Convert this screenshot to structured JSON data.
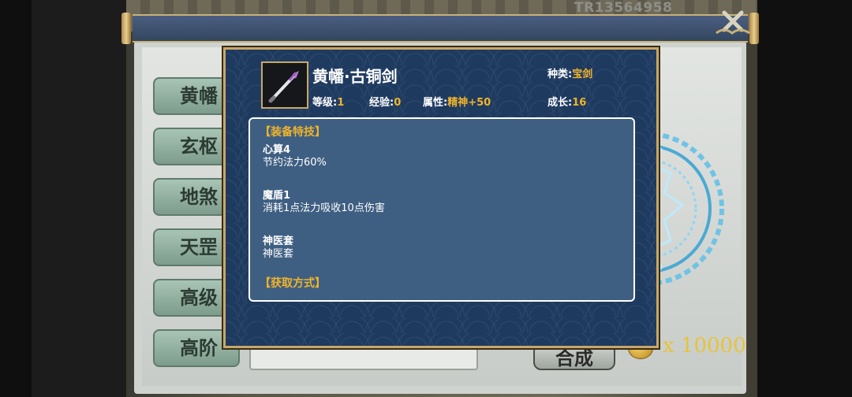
{
  "header": {
    "player_code": "TR13564958"
  },
  "tabs": [
    {
      "label": "黄幡"
    },
    {
      "label": "玄枢"
    },
    {
      "label": "地煞"
    },
    {
      "label": "天罡"
    },
    {
      "label": "高级"
    },
    {
      "label": "高阶"
    }
  ],
  "bottom": {
    "synth_label": "合成",
    "coin_count": "x 10000"
  },
  "tooltip": {
    "item_name": "黄幡·古铜剑",
    "type_label": "种类:",
    "type_value": "宝剑",
    "level_label": "等级:",
    "level_value": "1",
    "exp_label": "经验:",
    "exp_value": "0",
    "attr_label": "属性:",
    "attr_value": "精神+50",
    "growth_label": "成长:",
    "growth_value": "16",
    "section_title": "【装备特技】",
    "skills": [
      {
        "name": "心算4",
        "desc": "节约法力60%"
      },
      {
        "name": "魔盾1",
        "desc": "消耗1点法力吸收10点伤害"
      },
      {
        "name": "神医套",
        "desc": "神医套"
      }
    ],
    "section_title2": "【获取方式】"
  },
  "icons": {
    "close": "close-icon",
    "item": "sword-icon",
    "coin": "coin-icon"
  },
  "colors": {
    "dialog_bg": "#1f3a5f",
    "gold_text": "#f0b429",
    "border_gold": "#c7a86a"
  }
}
